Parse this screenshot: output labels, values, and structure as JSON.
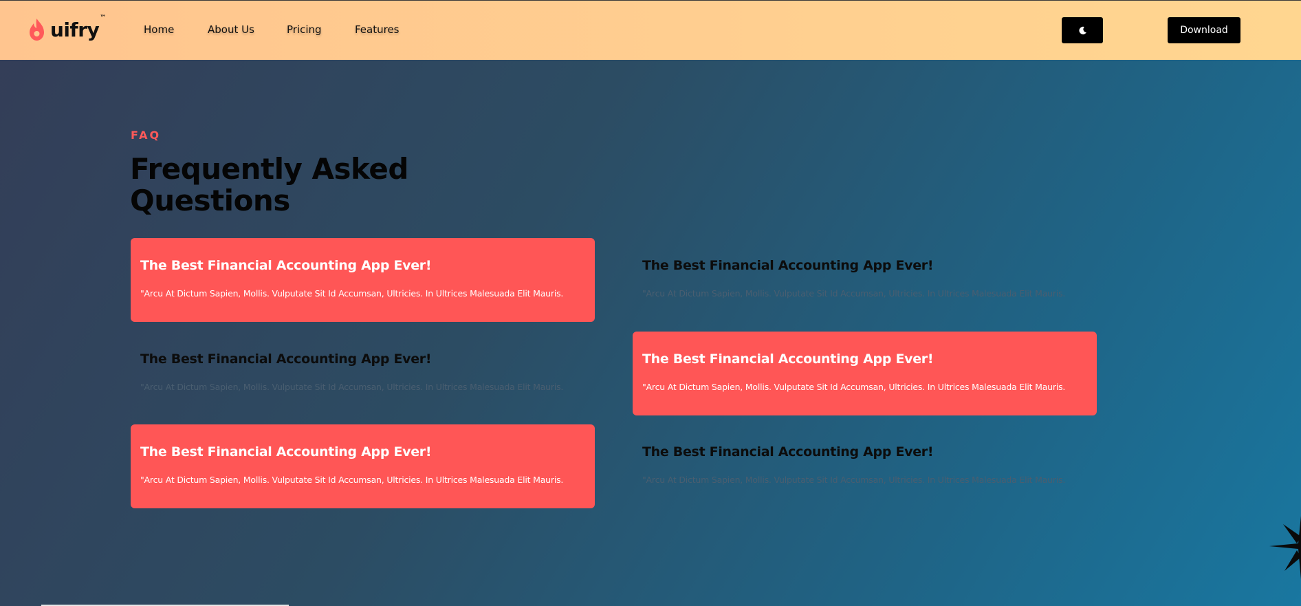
{
  "brand": {
    "name": "uifry",
    "tm": "™",
    "accent_color": "#ff5a5a",
    "logo_icon": "flame-icon"
  },
  "nav": {
    "links": [
      "Home",
      "About Us",
      "Pricing",
      "Features"
    ],
    "theme_toggle_icon": "moon-icon",
    "download_label": "Download"
  },
  "faq": {
    "eyebrow": "FAQ",
    "title": "Frequently Asked Questions",
    "items": [
      {
        "question": "The Best Financial Accounting App Ever!",
        "answer": "\"Arcu At Dictum Sapien, Mollis. Vulputate Sit Id Accumsan, Ultricies. In Ultrices Malesuada Elit Mauris.",
        "active": true
      },
      {
        "question": "The Best Financial Accounting App Ever!",
        "answer": "\"Arcu At Dictum Sapien, Mollis. Vulputate Sit Id Accumsan, Ultricies. In Ultrices Malesuada Elit Mauris.",
        "active": false
      },
      {
        "question": "The Best Financial Accounting App Ever!",
        "answer": "\"Arcu At Dictum Sapien, Mollis. Vulputate Sit Id Accumsan, Ultricies. In Ultrices Malesuada Elit Mauris.",
        "active": false
      },
      {
        "question": "The Best Financial Accounting App Ever!",
        "answer": "\"Arcu At Dictum Sapien, Mollis. Vulputate Sit Id Accumsan, Ultricies. In Ultrices Malesuada Elit Mauris.",
        "active": true
      },
      {
        "question": "The Best Financial Accounting App Ever!",
        "answer": "\"Arcu At Dictum Sapien, Mollis. Vulputate Sit Id Accumsan, Ultricies. In Ultrices Malesuada Elit Mauris.",
        "active": true
      },
      {
        "question": "The Best Financial Accounting App Ever!",
        "answer": "\"Arcu At Dictum Sapien, Mollis. Vulputate Sit Id Accumsan, Ultricies. In Ultrices Malesuada Elit Mauris.",
        "active": false
      }
    ]
  },
  "decor": {
    "corner_icon": "sparkle-icon"
  }
}
